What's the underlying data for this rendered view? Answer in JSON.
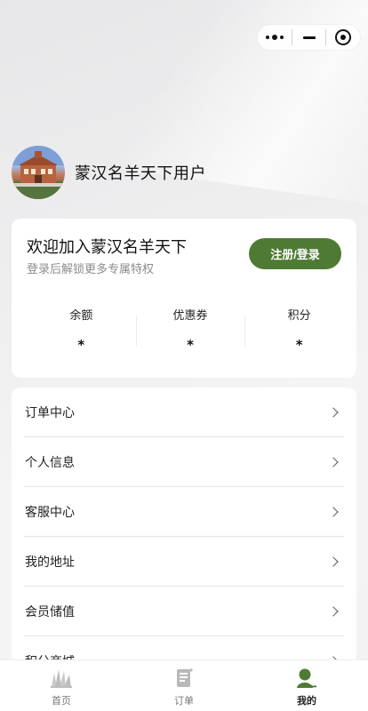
{
  "capsule": {
    "more_icon": "more-dots-icon",
    "minimize_icon": "minimize-icon",
    "close_icon": "target-circle-icon"
  },
  "profile": {
    "username": "蒙汉名羊天下用户",
    "avatar_icon": "building-avatar-image"
  },
  "welcome": {
    "title": "欢迎加入蒙汉名羊天下",
    "subtitle": "登录后解锁更多专属特权",
    "login_button": "注册/登录",
    "accent_color": "#4f7a33"
  },
  "stats": [
    {
      "label": "余额",
      "value": "*"
    },
    {
      "label": "优惠券",
      "value": "*"
    },
    {
      "label": "积分",
      "value": "*"
    }
  ],
  "menu": [
    {
      "label": "订单中心"
    },
    {
      "label": "个人信息"
    },
    {
      "label": "客服中心"
    },
    {
      "label": "我的地址"
    },
    {
      "label": "会员储值"
    },
    {
      "label": "积分商城"
    }
  ],
  "tabbar": [
    {
      "label": "首页",
      "icon": "grass-home-icon",
      "active": false
    },
    {
      "label": "订单",
      "icon": "order-book-icon",
      "active": false
    },
    {
      "label": "我的",
      "icon": "user-profile-icon",
      "active": true
    }
  ]
}
